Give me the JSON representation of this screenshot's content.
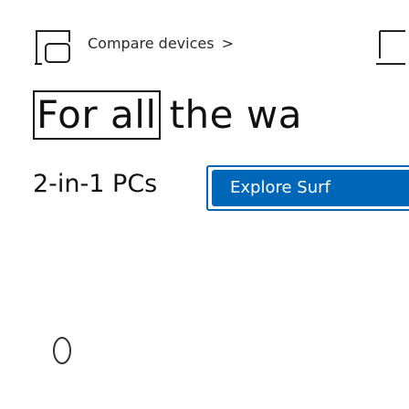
{
  "compare": {
    "link_label": "Compare devices",
    "chevron": ">"
  },
  "headline": {
    "boxed": "For all",
    "rest": "the wa"
  },
  "subhead": {
    "text": "2-in-1 PCs"
  },
  "cta": {
    "label": "Explore Surf"
  },
  "icons": {
    "device_icon": "laptop-tablet-icon",
    "device_icon_2": "laptop-icon",
    "chevron": "chevron-right-icon",
    "pause": "pause-icon"
  },
  "colors": {
    "accent": "#0067b8",
    "text": "#111111",
    "background": "#ffffff"
  }
}
